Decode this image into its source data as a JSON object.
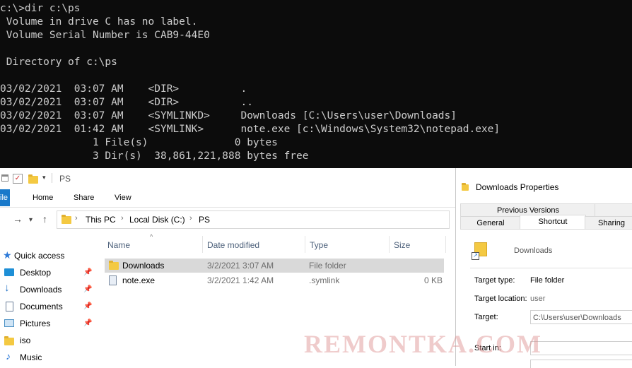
{
  "console": {
    "lines": [
      "c:\\>dir c:\\ps",
      " Volume in drive C has no label.",
      " Volume Serial Number is CAB9-44E0",
      "",
      " Directory of c:\\ps",
      "",
      "03/02/2021  03:07 AM    <DIR>          .",
      "03/02/2021  03:07 AM    <DIR>          ..",
      "03/02/2021  03:07 AM    <SYMLINKD>     Downloads [C:\\Users\\user\\Downloads]",
      "03/02/2021  01:42 AM    <SYMLINK>      note.exe [c:\\Windows\\System32\\notepad.exe]",
      "               1 File(s)              0 bytes",
      "               3 Dir(s)  38,861,221,888 bytes free"
    ]
  },
  "explorer": {
    "window_title": "PS",
    "ribbon": {
      "file": "ile",
      "home": "Home",
      "share": "Share",
      "view": "View"
    },
    "breadcrumb": [
      "This PC",
      "Local Disk (C:)",
      "PS"
    ],
    "columns": {
      "name": "Name",
      "date": "Date modified",
      "type": "Type",
      "size": "Size"
    },
    "files": [
      {
        "name": "Downloads",
        "date": "3/2/2021 3:07 AM",
        "type": "File folder",
        "size": "",
        "icon": "folder-icon"
      },
      {
        "name": "note.exe",
        "date": "3/2/2021 1:42 AM",
        "type": ".symlink",
        "size": "0 KB",
        "icon": "file-shortcut-icon"
      }
    ],
    "nav": [
      {
        "label": "Quick access",
        "icon": "star-icon",
        "color": "#2b79d8"
      },
      {
        "label": "Desktop",
        "icon": "desktop-icon",
        "color": "#1e8fd6"
      },
      {
        "label": "Downloads",
        "icon": "download-icon",
        "color": "#1e6fc4"
      },
      {
        "label": "Documents",
        "icon": "document-icon",
        "color": "#6b7f99"
      },
      {
        "label": "Pictures",
        "icon": "pictures-icon",
        "color": "#4a90c4"
      },
      {
        "label": "iso",
        "icon": "folder-icon",
        "color": "#f4c942"
      },
      {
        "label": "Music",
        "icon": "music-icon",
        "color": "#2b79d8"
      }
    ]
  },
  "properties": {
    "title": "Downloads Properties",
    "tabs_row1": [
      "Previous Versions"
    ],
    "tabs_row2": [
      "General",
      "Shortcut",
      "Sharing"
    ],
    "active_tab": "Shortcut",
    "item_name": "Downloads",
    "target_type_label": "Target type:",
    "target_type_value": "File folder",
    "target_location_label": "Target location:",
    "target_location_value": "user",
    "target_label": "Target:",
    "target_value": "C:\\Users\\user\\Downloads",
    "start_in_label": "Start in:"
  },
  "watermark": "REMONTKA.COM"
}
